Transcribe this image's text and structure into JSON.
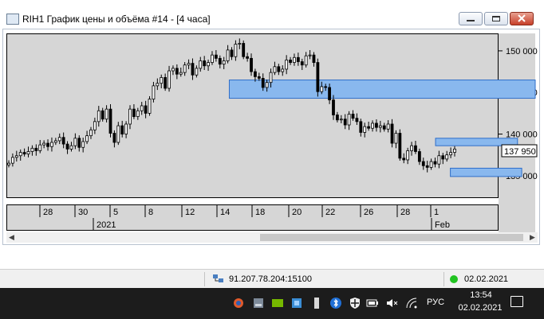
{
  "window": {
    "title": "RIH1 График цены и объёма #14 - [4 часа]"
  },
  "chart_data": {
    "type": "candlestick",
    "y_ticks": [
      "150 000",
      "145 000",
      "140 000",
      "135 000"
    ],
    "ylim": [
      132500,
      152000
    ],
    "current_price": "137 950",
    "date_ticks": [
      "28",
      "30",
      "5",
      "8",
      "12",
      "14",
      "18",
      "20",
      "22",
      "26",
      "28",
      "1",
      "Feb"
    ],
    "year_ticks": [
      "2021",
      "Feb"
    ],
    "zones": [
      {
        "from": 144300,
        "to": 146500,
        "x_from": 0.42,
        "x_to": 1.0
      },
      {
        "from": 138600,
        "to": 139500,
        "x_from": 0.81,
        "x_to": 0.965
      },
      {
        "from": 134900,
        "to": 135900,
        "x_from": 0.838,
        "x_to": 0.973
      }
    ],
    "closes": [
      136500,
      137200,
      137400,
      137800,
      137600,
      137900,
      138300,
      138000,
      138700,
      138900,
      138500,
      139000,
      139200,
      139600,
      138800,
      138200,
      138600,
      139500,
      138400,
      139100,
      139800,
      140500,
      141500,
      142800,
      141800,
      143000,
      140100,
      139000,
      141000,
      140000,
      141200,
      143000,
      142100,
      142800,
      143400,
      142500,
      144200,
      145800,
      146100,
      146800,
      145500,
      147600,
      147900,
      147200,
      147400,
      148300,
      148500,
      147100,
      147900,
      148800,
      148200,
      148600,
      149500,
      149100,
      148400,
      148800,
      150100,
      149300,
      150800,
      150900,
      149300,
      149100,
      147500,
      146900,
      146700,
      145600,
      146200,
      147400,
      148100,
      147500,
      147800,
      148900,
      148600,
      149200,
      148700,
      148300,
      149400,
      149500,
      148600,
      145100,
      145700,
      145600,
      144100,
      142300,
      141700,
      141800,
      141100,
      142400,
      141900,
      141500,
      140200,
      140900,
      140700,
      141300,
      140800,
      141000,
      140600,
      141200,
      138900,
      140100,
      137100,
      136900,
      138000,
      138600,
      137900,
      136700,
      136200,
      136000,
      136700,
      136400,
      137400,
      137000,
      137500,
      137800,
      138200
    ]
  },
  "statusbar": {
    "connection": "91.207.78.204:15100",
    "date": "02.02.2021"
  },
  "taskbar": {
    "language": "РУС",
    "time": "13:54",
    "date": "02.02.2021"
  },
  "colors": {
    "zone_fill": "#89b8ee",
    "zone_stroke": "#2f6ec9",
    "plot_bg": "#d6d6d6",
    "status_online": "#21c321"
  }
}
